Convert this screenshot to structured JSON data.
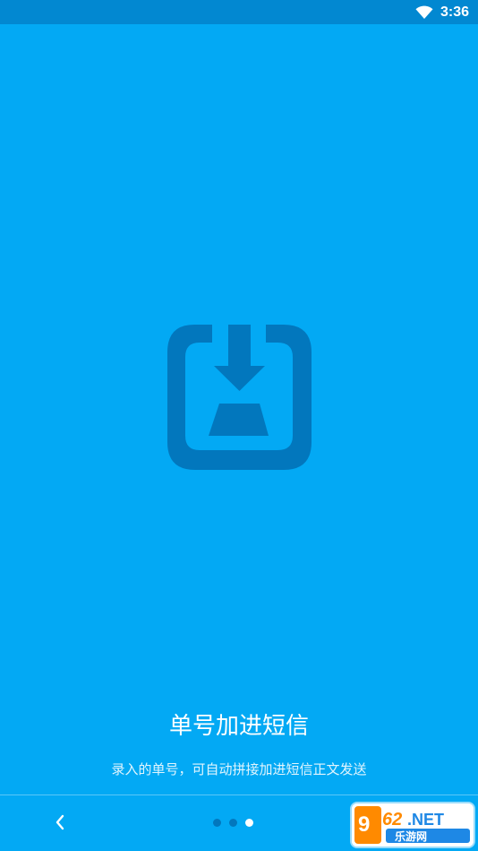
{
  "status_bar": {
    "time": "3:36",
    "wifi_icon": "wifi-icon"
  },
  "hero": {
    "icon": "download-import-icon",
    "title": "单号加进短信",
    "subtitle": "录入的单号，可自动拼接加进短信正文发送"
  },
  "navigation": {
    "back_icon": "chevron-left-icon",
    "page_indicator": {
      "total": 3,
      "active": 3
    }
  },
  "watermark": {
    "text": "962.NET 乐游网"
  },
  "colors": {
    "background": "#03A9F4",
    "status_bar": "#0288D1",
    "icon_dark": "#0277BD",
    "text": "#FFFFFF"
  }
}
